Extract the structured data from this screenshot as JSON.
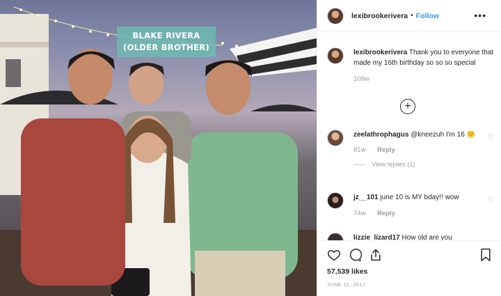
{
  "photo": {
    "caption_line1": "BLAKE RIVERA",
    "caption_line2": "(OLDER BROTHER)"
  },
  "header": {
    "username": "lexibrookerivera",
    "separator": "•",
    "follow_label": "Follow",
    "more_label": "•••"
  },
  "caption": {
    "username": "lexibrookerivera",
    "text": "Thank you to everyone that made my 16th birthday so so so special",
    "age": "109w"
  },
  "comments": [
    {
      "username": "zeelathrophagus",
      "text": "@kneezuh I'm 16 😕",
      "age": "81w",
      "reply_label": "Reply",
      "view_replies": "View replies (1)"
    },
    {
      "username": "jz__101",
      "text": "june 10 is MY bday!! wow",
      "age": "74w",
      "reply_label": "Reply"
    },
    {
      "username": "lizzie_lizard17",
      "text": "How old are you"
    }
  ],
  "actions": {
    "likes": "57,539 likes",
    "date": "JUNE 11, 2017"
  },
  "icons": [
    "heart-icon",
    "comment-icon",
    "share-icon",
    "bookmark-icon",
    "plus-circle-icon",
    "more-icon"
  ]
}
